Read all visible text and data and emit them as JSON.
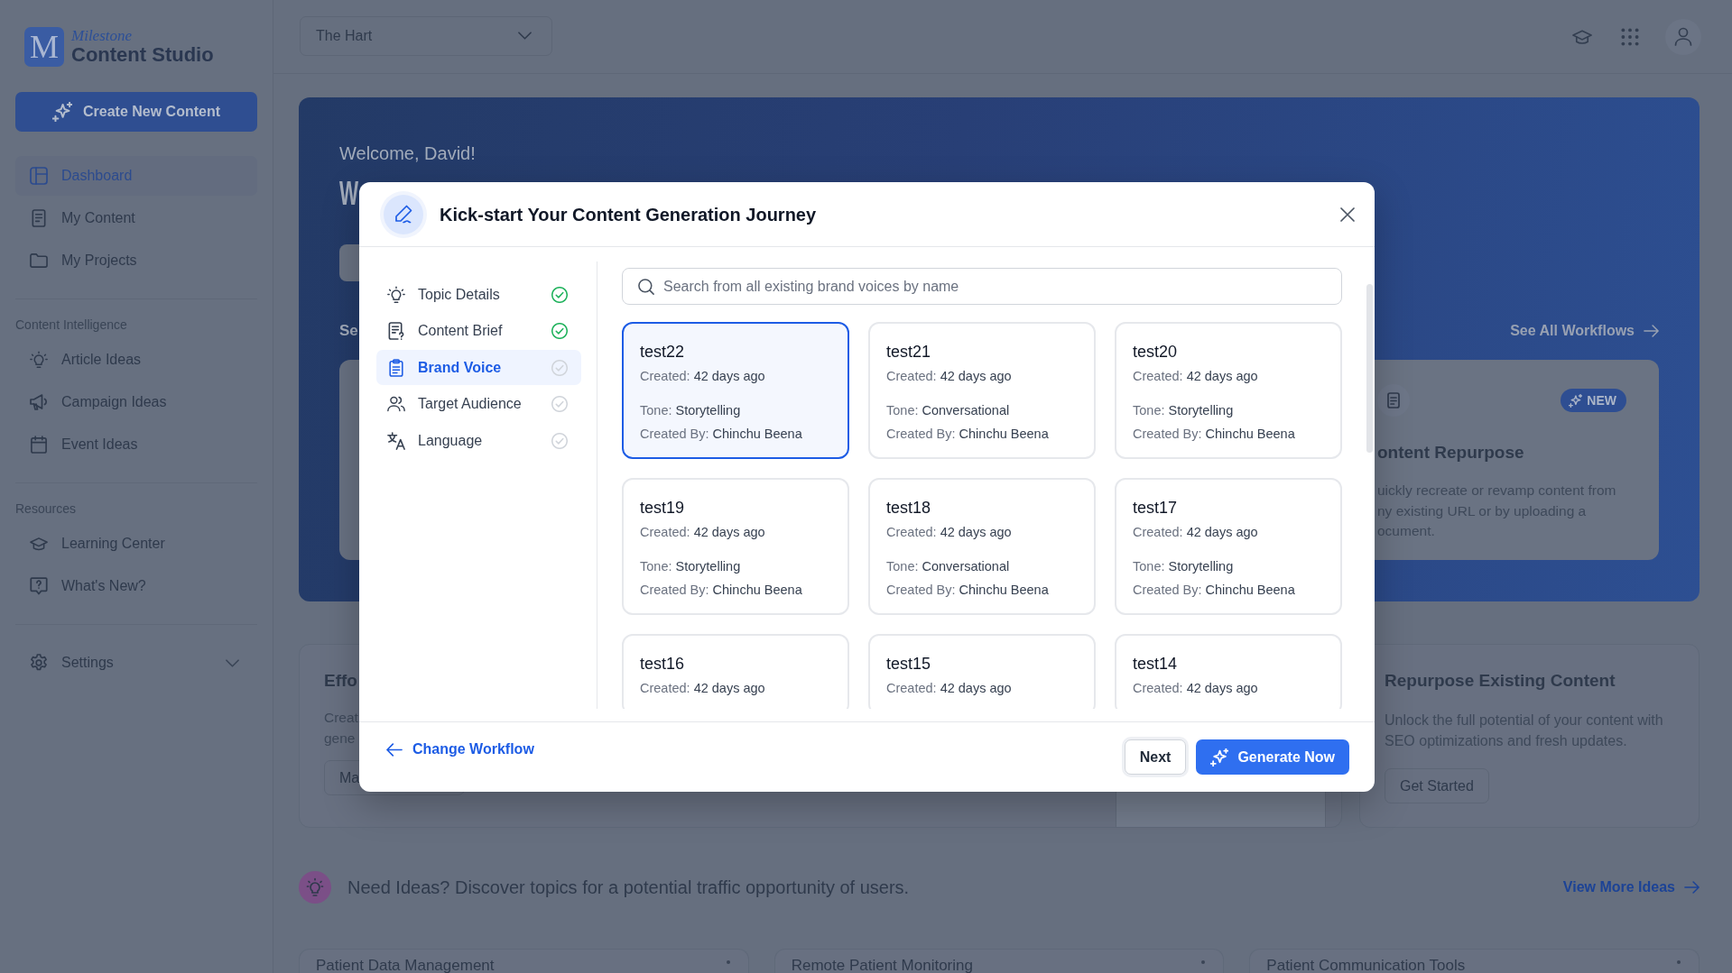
{
  "sidebar": {
    "logo": {
      "mark": "M",
      "brand": "Milestone",
      "product": "Content Studio"
    },
    "create_button": "Create New Content",
    "groups": [
      {
        "items": [
          {
            "label": "Dashboard",
            "selected": true
          },
          {
            "label": "My Content",
            "selected": false
          },
          {
            "label": "My Projects",
            "selected": false
          }
        ]
      },
      {
        "heading": "Content Intelligence",
        "items": [
          {
            "label": "Article Ideas",
            "selected": false
          },
          {
            "label": "Campaign Ideas",
            "selected": false
          },
          {
            "label": "Event Ideas",
            "selected": false
          }
        ]
      },
      {
        "heading": "Resources",
        "items": [
          {
            "label": "Learning Center",
            "selected": false
          },
          {
            "label": "What's New?",
            "selected": false
          }
        ]
      },
      {
        "items": [
          {
            "label": "Settings",
            "selected": false,
            "expanded": false
          }
        ]
      }
    ]
  },
  "topbar": {
    "workspace": "The Hart"
  },
  "hero": {
    "greeting": "Welcome, David!",
    "heading": "W",
    "section_title": "Se",
    "see_all": "See All Workflows",
    "workflow_card": {
      "badge": "NEW",
      "title": "ontent Repurpose",
      "description_lines": [
        "uickly recreate or revamp content from",
        "ny existing URL or by uploading a",
        "ocument."
      ]
    }
  },
  "features": [
    {
      "kind": "preview",
      "title": "Effo",
      "description_lines": [
        "Creat",
        "gene"
      ],
      "button": "Ma"
    },
    {
      "kind": "basic",
      "title": "Repurpose Existing Content",
      "description": "Unlock the full potential of your content with SEO optimizations and fresh updates.",
      "button": "Get Started"
    }
  ],
  "ideas": {
    "text": "Need Ideas? Discover topics for a potential traffic opportunity of users.",
    "link": "View More Ideas",
    "cards": [
      {
        "title": "Patient Data Management"
      },
      {
        "title": "Remote Patient Monitoring"
      },
      {
        "title": "Patient Communication Tools"
      }
    ]
  },
  "modal": {
    "title": "Kick-start Your Content Generation Journey",
    "steps": [
      {
        "label": "Topic Details",
        "selected": false,
        "done": true
      },
      {
        "label": "Content Brief",
        "selected": false,
        "done": true
      },
      {
        "label": "Brand Voice",
        "selected": true,
        "done": false
      },
      {
        "label": "Target Audience",
        "selected": false,
        "done": false
      },
      {
        "label": "Language",
        "selected": false,
        "done": false
      }
    ],
    "search": {
      "placeholder": "Search from all existing brand voices by name"
    },
    "voices": [
      {
        "name": "test22",
        "selected": true,
        "details": [
          {
            "label": "Created:",
            "value": "42 days ago"
          },
          {
            "label": "Tone:",
            "value": "Storytelling"
          },
          {
            "label": "Created By:",
            "value": "Chinchu Beena"
          }
        ]
      },
      {
        "name": "test21",
        "selected": false,
        "details": [
          {
            "label": "Created:",
            "value": "42 days ago"
          },
          {
            "label": "Tone:",
            "value": "Conversational"
          },
          {
            "label": "Created By:",
            "value": "Chinchu Beena"
          }
        ]
      },
      {
        "name": "test20",
        "selected": false,
        "details": [
          {
            "label": "Created:",
            "value": "42 days ago"
          },
          {
            "label": "Tone:",
            "value": "Storytelling"
          },
          {
            "label": "Created By:",
            "value": "Chinchu Beena"
          }
        ]
      },
      {
        "name": "test19",
        "selected": false,
        "details": [
          {
            "label": "Created:",
            "value": "42 days ago"
          },
          {
            "label": "Tone:",
            "value": "Storytelling"
          },
          {
            "label": "Created By:",
            "value": "Chinchu Beena"
          }
        ]
      },
      {
        "name": "test18",
        "selected": false,
        "details": [
          {
            "label": "Created:",
            "value": "42 days ago"
          },
          {
            "label": "Tone:",
            "value": "Conversational"
          },
          {
            "label": "Created By:",
            "value": "Chinchu Beena"
          }
        ]
      },
      {
        "name": "test17",
        "selected": false,
        "details": [
          {
            "label": "Created:",
            "value": "42 days ago"
          },
          {
            "label": "Tone:",
            "value": "Storytelling"
          },
          {
            "label": "Created By:",
            "value": "Chinchu Beena"
          }
        ]
      },
      {
        "name": "test16",
        "selected": false,
        "details": [
          {
            "label": "Created:",
            "value": "42 days ago"
          }
        ]
      },
      {
        "name": "test15",
        "selected": false,
        "details": [
          {
            "label": "Created:",
            "value": "42 days ago"
          }
        ]
      },
      {
        "name": "test14",
        "selected": false,
        "details": [
          {
            "label": "Created:",
            "value": "42 days ago"
          }
        ]
      }
    ],
    "back_link": "Change Workflow",
    "buttons": [
      {
        "label": "Next",
        "kind": "secondary"
      },
      {
        "label": "Generate Now",
        "kind": "primary"
      }
    ]
  }
}
